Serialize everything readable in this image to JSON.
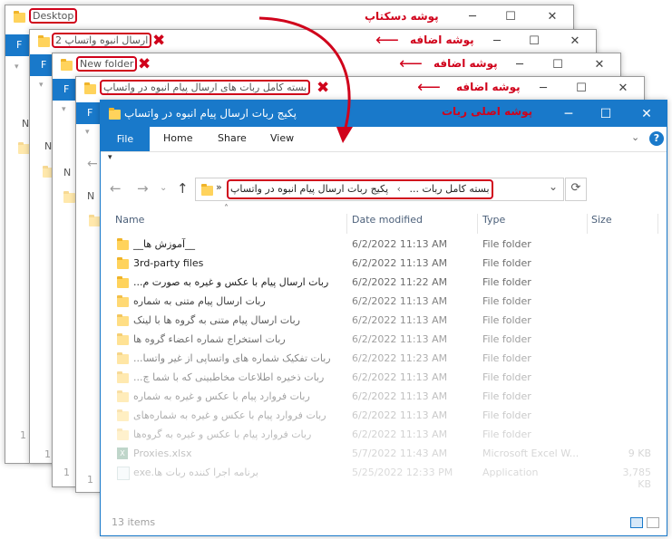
{
  "annotations": {
    "desktop_folder": "پوشه دسکتاپ",
    "extra_folder_1": "پوشه اضافه",
    "extra_folder_2": "پوشه اضافه",
    "extra_folder_3": "پوشه اضافه",
    "main_folder": "پوشه اصلی ربات",
    "arrow_color": "#d0021b"
  },
  "back_windows": {
    "desktop_title": "Desktop",
    "win2_title": "ارسال انبوه واتساپ 2",
    "win3_title": "New folder",
    "win4_title": "بسته کامل ربات های ارسال پیام انبوه در واتساپ",
    "ribbon_letter": "F",
    "side_letter": "N",
    "status_prefix": "1"
  },
  "main_window": {
    "title": "پکیج ربات ارسال پیام انبوه در واتساپ",
    "tabs": [
      "File",
      "Home",
      "Share",
      "View"
    ],
    "address": {
      "overflow": "»",
      "crumb_1": "بسته کامل ربات ...",
      "separator": "›",
      "crumb_2": "پکیج ربات ارسال پیام انبوه در واتساپ"
    },
    "columns": {
      "name": "Name",
      "date": "Date modified",
      "type": "Type",
      "size": "Size"
    },
    "files": [
      {
        "name": "__آموزش ها__",
        "date": "6/2/2022 11:13 AM",
        "type": "File folder",
        "size": "",
        "icon": "folder-icon"
      },
      {
        "name": "3rd-party files",
        "date": "6/2/2022 11:13 AM",
        "type": "File folder",
        "size": "",
        "icon": "folder-icon"
      },
      {
        "name": "ربات ارسال پیام با عکس و غیره به صورت م...",
        "date": "6/2/2022 11:22 AM",
        "type": "File folder",
        "size": "",
        "icon": "folder-icon"
      },
      {
        "name": "ربات ارسال پیام متنی به شماره",
        "date": "6/2/2022 11:13 AM",
        "type": "File folder",
        "size": "",
        "icon": "folder-icon"
      },
      {
        "name": "ربات ارسال پیام متنی به گروه ها با لینک",
        "date": "6/2/2022 11:13 AM",
        "type": "File folder",
        "size": "",
        "icon": "folder-icon"
      },
      {
        "name": "ربات استخراج شماره اعضاء گروه ها",
        "date": "6/2/2022 11:13 AM",
        "type": "File folder",
        "size": "",
        "icon": "folder-icon"
      },
      {
        "name": "ربات تفکیک شماره های واتساپی از غیر واتسا...",
        "date": "6/2/2022 11:23 AM",
        "type": "File folder",
        "size": "",
        "icon": "folder-icon"
      },
      {
        "name": "ربات ذخیره اطلاعات مخاطبینی که با شما چ...",
        "date": "6/2/2022 11:13 AM",
        "type": "File folder",
        "size": "",
        "icon": "folder-icon"
      },
      {
        "name": "ربات فروارد پیام با عکس و غیره به شماره",
        "date": "6/2/2022 11:13 AM",
        "type": "File folder",
        "size": "",
        "icon": "folder-icon"
      },
      {
        "name": "ربات فروارد پیام با عکس و غیره به شماره‌های",
        "date": "6/2/2022 11:13 AM",
        "type": "File folder",
        "size": "",
        "icon": "folder-icon"
      },
      {
        "name": "ربات فروارد پیام با عکس و غیره به گروه‌ها",
        "date": "6/2/2022 11:13 AM",
        "type": "File folder",
        "size": "",
        "icon": "folder-icon"
      },
      {
        "name": "Proxies.xlsx",
        "date": "5/7/2022 11:43 AM",
        "type": "Microsoft Excel W...",
        "size": "9 KB",
        "icon": "excel-icon"
      },
      {
        "name": "برنامه اجرا کننده ربات ها.exe",
        "date": "5/25/2022 12:33 PM",
        "type": "Application",
        "size": "3,785 KB",
        "icon": "app-icon"
      }
    ],
    "status": "13 items"
  }
}
